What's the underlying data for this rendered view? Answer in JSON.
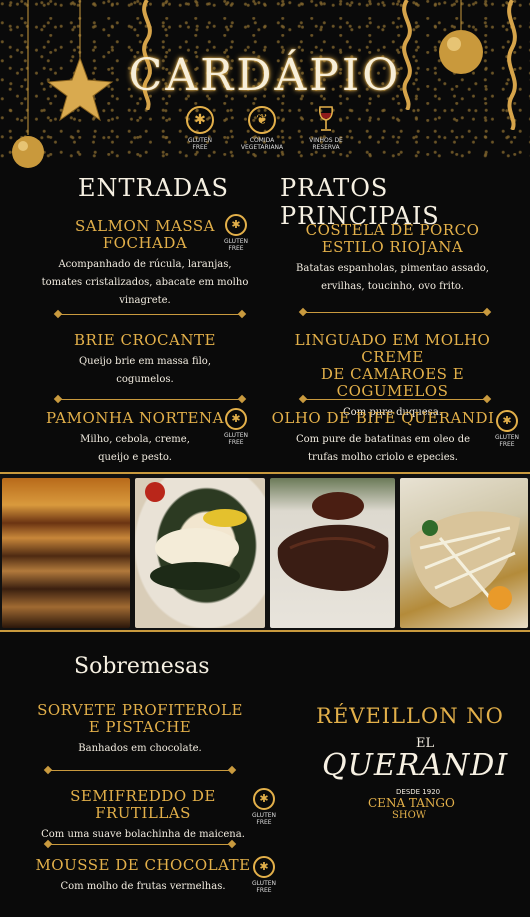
{
  "header": {
    "title": "CARDÁPIO",
    "badges": [
      {
        "icon": "wheat-crossed-icon",
        "glyph": "✱",
        "label_1": "GLUTEN",
        "label_2": "FREE"
      },
      {
        "icon": "leaf-icon",
        "glyph": "❦",
        "label_1": "COMIDA",
        "label_2": "VEGETARIANA"
      },
      {
        "icon": "wine-glass-icon",
        "glyph": "♆",
        "label_1": "VINHOS DE",
        "label_2": "RESERVA"
      }
    ]
  },
  "entradas": {
    "heading": "ENTRADAS",
    "items": [
      {
        "name_1": "SALMON MASSA",
        "name_2": "FOCHADA",
        "desc_1": "Acompanhado de rúcula, laranjas,",
        "desc_2": "tomates cristalizados, abacate em molho",
        "desc_3": "vinagrete.",
        "gluten_free": true
      },
      {
        "name_1": "BRIE CROCANTE",
        "desc_1": "Queijo brie em massa filo,",
        "desc_2": "cogumelos.",
        "gluten_free": false
      },
      {
        "name_1": "PAMONHA NORTENA",
        "desc_1": "Milho, cebola, creme,",
        "desc_2": "queijo e pesto.",
        "gluten_free": true
      }
    ]
  },
  "principais": {
    "heading": "PRATOS PRINCIPAIS",
    "items": [
      {
        "name_1": "COSTELA DE PORCO",
        "name_2": "ESTILO RIOJANA",
        "desc_1": "Batatas espanholas, pimentao assado,",
        "desc_2": "ervilhas, toucinho, ovo frito.",
        "gluten_free": false
      },
      {
        "name_1": "LINGUADO EM MOLHO CREME",
        "name_2": "DE CAMAROES E COGUMELOS",
        "desc_1": "Com pure duquesa.",
        "gluten_free": false
      },
      {
        "name_1": "OLHO DE BIFE QUERANDI",
        "desc_1": "Com pure de batatinas em oleo de",
        "desc_2": "trufas molho criolo e epecies.",
        "gluten_free": true
      }
    ]
  },
  "sobremesas": {
    "heading": "Sobremesas",
    "items": [
      {
        "name_1": "SORVETE PROFITEROLE",
        "name_2": "E PISTACHE",
        "desc_1": "Banhados em chocolate.",
        "gluten_free": false
      },
      {
        "name_1": "SEMIFREDDO DE FRUTILLAS",
        "desc_1": "Com uma suave bolachinha de maicena.",
        "gluten_free": true
      },
      {
        "name_1": "MOUSSE DE CHOCOLATE",
        "desc_1": "Com molho de frutas vermelhas.",
        "gluten_free": true
      }
    ]
  },
  "gluten_label_1": "GLUTEN",
  "gluten_label_2": "FREE",
  "gluten_glyph": "✱",
  "promo": {
    "line": "RÉVEILLON NO",
    "brand_small": "EL",
    "brand": "QUERANDI",
    "since": "DESDE 1920",
    "show_1": "CENA TANGO",
    "show_2": "SHOW"
  },
  "photos": [
    {
      "name": "dessert-cake-photo"
    },
    {
      "name": "fish-dish-photo"
    },
    {
      "name": "steak-photo"
    },
    {
      "name": "salad-photo"
    }
  ],
  "colors": {
    "gold": "#e3b04a",
    "background": "#0a0a0a",
    "text": "#f2ece0"
  }
}
